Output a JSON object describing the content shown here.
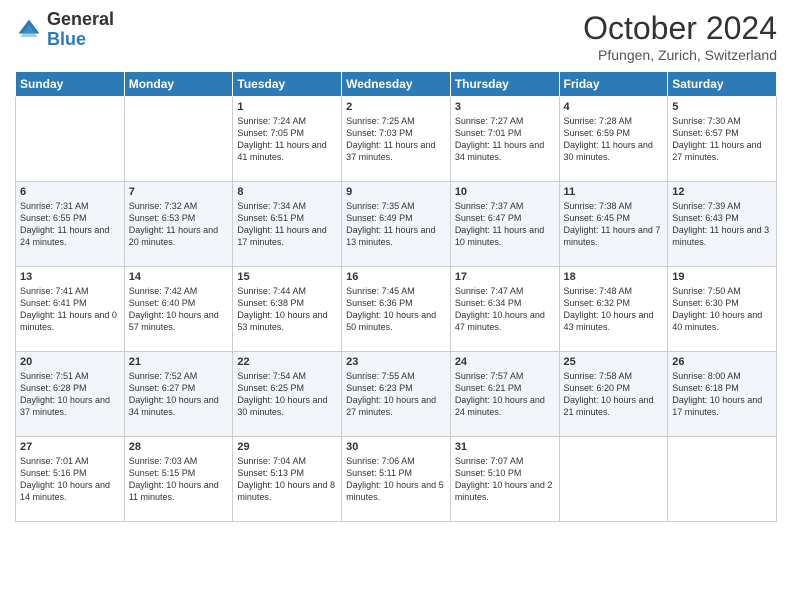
{
  "logo": {
    "general": "General",
    "blue": "Blue"
  },
  "header": {
    "month": "October 2024",
    "location": "Pfungen, Zurich, Switzerland"
  },
  "weekdays": [
    "Sunday",
    "Monday",
    "Tuesday",
    "Wednesday",
    "Thursday",
    "Friday",
    "Saturday"
  ],
  "weeks": [
    [
      {
        "day": "",
        "sunrise": "",
        "sunset": "",
        "daylight": ""
      },
      {
        "day": "",
        "sunrise": "",
        "sunset": "",
        "daylight": ""
      },
      {
        "day": "1",
        "sunrise": "Sunrise: 7:24 AM",
        "sunset": "Sunset: 7:05 PM",
        "daylight": "Daylight: 11 hours and 41 minutes."
      },
      {
        "day": "2",
        "sunrise": "Sunrise: 7:25 AM",
        "sunset": "Sunset: 7:03 PM",
        "daylight": "Daylight: 11 hours and 37 minutes."
      },
      {
        "day": "3",
        "sunrise": "Sunrise: 7:27 AM",
        "sunset": "Sunset: 7:01 PM",
        "daylight": "Daylight: 11 hours and 34 minutes."
      },
      {
        "day": "4",
        "sunrise": "Sunrise: 7:28 AM",
        "sunset": "Sunset: 6:59 PM",
        "daylight": "Daylight: 11 hours and 30 minutes."
      },
      {
        "day": "5",
        "sunrise": "Sunrise: 7:30 AM",
        "sunset": "Sunset: 6:57 PM",
        "daylight": "Daylight: 11 hours and 27 minutes."
      }
    ],
    [
      {
        "day": "6",
        "sunrise": "Sunrise: 7:31 AM",
        "sunset": "Sunset: 6:55 PM",
        "daylight": "Daylight: 11 hours and 24 minutes."
      },
      {
        "day": "7",
        "sunrise": "Sunrise: 7:32 AM",
        "sunset": "Sunset: 6:53 PM",
        "daylight": "Daylight: 11 hours and 20 minutes."
      },
      {
        "day": "8",
        "sunrise": "Sunrise: 7:34 AM",
        "sunset": "Sunset: 6:51 PM",
        "daylight": "Daylight: 11 hours and 17 minutes."
      },
      {
        "day": "9",
        "sunrise": "Sunrise: 7:35 AM",
        "sunset": "Sunset: 6:49 PM",
        "daylight": "Daylight: 11 hours and 13 minutes."
      },
      {
        "day": "10",
        "sunrise": "Sunrise: 7:37 AM",
        "sunset": "Sunset: 6:47 PM",
        "daylight": "Daylight: 11 hours and 10 minutes."
      },
      {
        "day": "11",
        "sunrise": "Sunrise: 7:38 AM",
        "sunset": "Sunset: 6:45 PM",
        "daylight": "Daylight: 11 hours and 7 minutes."
      },
      {
        "day": "12",
        "sunrise": "Sunrise: 7:39 AM",
        "sunset": "Sunset: 6:43 PM",
        "daylight": "Daylight: 11 hours and 3 minutes."
      }
    ],
    [
      {
        "day": "13",
        "sunrise": "Sunrise: 7:41 AM",
        "sunset": "Sunset: 6:41 PM",
        "daylight": "Daylight: 11 hours and 0 minutes."
      },
      {
        "day": "14",
        "sunrise": "Sunrise: 7:42 AM",
        "sunset": "Sunset: 6:40 PM",
        "daylight": "Daylight: 10 hours and 57 minutes."
      },
      {
        "day": "15",
        "sunrise": "Sunrise: 7:44 AM",
        "sunset": "Sunset: 6:38 PM",
        "daylight": "Daylight: 10 hours and 53 minutes."
      },
      {
        "day": "16",
        "sunrise": "Sunrise: 7:45 AM",
        "sunset": "Sunset: 6:36 PM",
        "daylight": "Daylight: 10 hours and 50 minutes."
      },
      {
        "day": "17",
        "sunrise": "Sunrise: 7:47 AM",
        "sunset": "Sunset: 6:34 PM",
        "daylight": "Daylight: 10 hours and 47 minutes."
      },
      {
        "day": "18",
        "sunrise": "Sunrise: 7:48 AM",
        "sunset": "Sunset: 6:32 PM",
        "daylight": "Daylight: 10 hours and 43 minutes."
      },
      {
        "day": "19",
        "sunrise": "Sunrise: 7:50 AM",
        "sunset": "Sunset: 6:30 PM",
        "daylight": "Daylight: 10 hours and 40 minutes."
      }
    ],
    [
      {
        "day": "20",
        "sunrise": "Sunrise: 7:51 AM",
        "sunset": "Sunset: 6:28 PM",
        "daylight": "Daylight: 10 hours and 37 minutes."
      },
      {
        "day": "21",
        "sunrise": "Sunrise: 7:52 AM",
        "sunset": "Sunset: 6:27 PM",
        "daylight": "Daylight: 10 hours and 34 minutes."
      },
      {
        "day": "22",
        "sunrise": "Sunrise: 7:54 AM",
        "sunset": "Sunset: 6:25 PM",
        "daylight": "Daylight: 10 hours and 30 minutes."
      },
      {
        "day": "23",
        "sunrise": "Sunrise: 7:55 AM",
        "sunset": "Sunset: 6:23 PM",
        "daylight": "Daylight: 10 hours and 27 minutes."
      },
      {
        "day": "24",
        "sunrise": "Sunrise: 7:57 AM",
        "sunset": "Sunset: 6:21 PM",
        "daylight": "Daylight: 10 hours and 24 minutes."
      },
      {
        "day": "25",
        "sunrise": "Sunrise: 7:58 AM",
        "sunset": "Sunset: 6:20 PM",
        "daylight": "Daylight: 10 hours and 21 minutes."
      },
      {
        "day": "26",
        "sunrise": "Sunrise: 8:00 AM",
        "sunset": "Sunset: 6:18 PM",
        "daylight": "Daylight: 10 hours and 17 minutes."
      }
    ],
    [
      {
        "day": "27",
        "sunrise": "Sunrise: 7:01 AM",
        "sunset": "Sunset: 5:16 PM",
        "daylight": "Daylight: 10 hours and 14 minutes."
      },
      {
        "day": "28",
        "sunrise": "Sunrise: 7:03 AM",
        "sunset": "Sunset: 5:15 PM",
        "daylight": "Daylight: 10 hours and 11 minutes."
      },
      {
        "day": "29",
        "sunrise": "Sunrise: 7:04 AM",
        "sunset": "Sunset: 5:13 PM",
        "daylight": "Daylight: 10 hours and 8 minutes."
      },
      {
        "day": "30",
        "sunrise": "Sunrise: 7:06 AM",
        "sunset": "Sunset: 5:11 PM",
        "daylight": "Daylight: 10 hours and 5 minutes."
      },
      {
        "day": "31",
        "sunrise": "Sunrise: 7:07 AM",
        "sunset": "Sunset: 5:10 PM",
        "daylight": "Daylight: 10 hours and 2 minutes."
      },
      {
        "day": "",
        "sunrise": "",
        "sunset": "",
        "daylight": ""
      },
      {
        "day": "",
        "sunrise": "",
        "sunset": "",
        "daylight": ""
      }
    ]
  ]
}
